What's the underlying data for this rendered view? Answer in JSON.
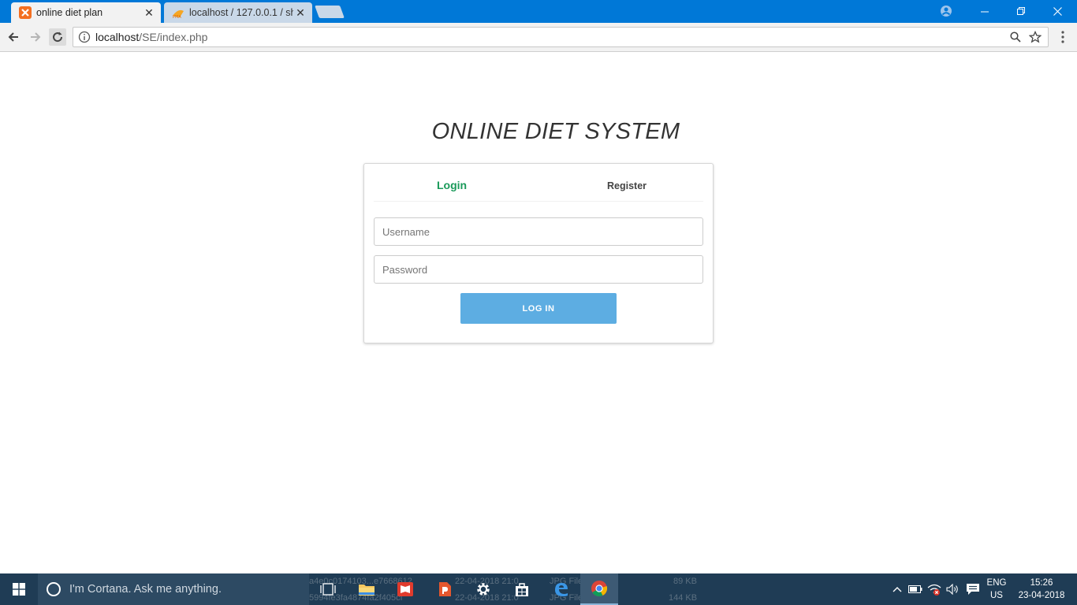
{
  "browser": {
    "tabs": [
      {
        "title": "online diet plan",
        "close": "✕",
        "active": true
      },
      {
        "title": "localhost / 127.0.0.1 / sh",
        "close": "✕",
        "active": false
      }
    ],
    "url_host": "localhost",
    "url_path": "/SE/index.php"
  },
  "page": {
    "title": "ONLINE DIET SYSTEM",
    "tabs": {
      "login": "Login",
      "register": "Register"
    },
    "username_placeholder": "Username",
    "password_placeholder": "Password",
    "login_button": "LOG IN"
  },
  "taskbar": {
    "cortana_placeholder": "I'm Cortana. Ask me anything.",
    "language": {
      "line1": "ENG",
      "line2": "US"
    },
    "time": "15:26",
    "date": "23-04-2018",
    "background_ghost": {
      "row1_name": "a4e0c0174103...e7668612",
      "row1_date": "22-04-2018 21:0",
      "row1_type": "JPG File",
      "row1_size": "89 KB",
      "row2_name": "5994fe3fa4874fa2f405cf",
      "row2_date": "22-04-2018 21:0",
      "row2_type": "JPG File",
      "row2_size": "144 KB"
    }
  },
  "colors": {
    "titlebar": "#0078d7",
    "login_tab": "#1a9a5a",
    "login_button": "#5dade2",
    "taskbar": "#1f3c55"
  }
}
